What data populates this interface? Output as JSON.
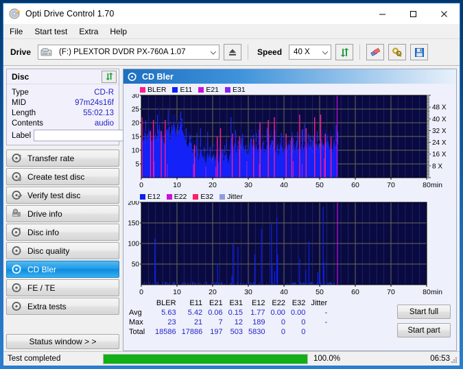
{
  "window": {
    "title": "Opti Drive Control 1.70",
    "icon": "disc-icon",
    "minimize": "–",
    "maximize": "□",
    "close": "✕"
  },
  "menu": {
    "items": [
      {
        "label": "File"
      },
      {
        "label": "Start test"
      },
      {
        "label": "Extra"
      },
      {
        "label": "Help"
      }
    ]
  },
  "toolbar": {
    "drive_label": "Drive",
    "drive_value": "(F:)  PLEXTOR DVDR   PX-760A 1.07",
    "eject_icon": "eject-icon",
    "speed_label": "Speed",
    "speed_value": "40 X",
    "refresh_icon": "refresh-arrows-icon",
    "erase_icon": "eraser-icon",
    "tools_icon": "tools-icon",
    "save_icon": "floppy-save-icon"
  },
  "disc_panel": {
    "title": "Disc",
    "refresh_icon": "refresh-arrows-icon",
    "rows": [
      {
        "key": "Type",
        "value": "CD-R"
      },
      {
        "key": "MID",
        "value": "97m24s16f"
      },
      {
        "key": "Length",
        "value": "55:02.13"
      },
      {
        "key": "Contents",
        "value": "audio"
      }
    ],
    "label_key": "Label",
    "label_value": "",
    "label_button_icon": "cd-label-icon"
  },
  "nav": {
    "items": [
      {
        "label": "Transfer rate",
        "icon": "disc-speed-icon",
        "selected": false
      },
      {
        "label": "Create test disc",
        "icon": "disc-burn-icon",
        "selected": false
      },
      {
        "label": "Verify test disc",
        "icon": "disc-check-icon",
        "selected": false
      },
      {
        "label": "Drive info",
        "icon": "drive-info-icon",
        "selected": false
      },
      {
        "label": "Disc info",
        "icon": "disc-info-icon",
        "selected": false
      },
      {
        "label": "Disc quality",
        "icon": "disc-quality-icon",
        "selected": false
      },
      {
        "label": "CD Bler",
        "icon": "cd-bler-icon",
        "selected": true
      },
      {
        "label": "FE / TE",
        "icon": "fe-te-icon",
        "selected": false
      },
      {
        "label": "Extra tests",
        "icon": "extra-tests-icon",
        "selected": false
      }
    ],
    "status_window_button": "Status window > >"
  },
  "panel": {
    "title": "CD Bler",
    "icon": "cd-bler-icon"
  },
  "stats": {
    "columns": [
      "BLER",
      "E11",
      "E21",
      "E31",
      "E12",
      "E22",
      "E32",
      "Jitter"
    ],
    "rows": [
      {
        "label": "Avg",
        "values": [
          "5.63",
          "5.42",
          "0.06",
          "0.15",
          "1.77",
          "0.00",
          "0.00",
          "-"
        ]
      },
      {
        "label": "Max",
        "values": [
          "23",
          "21",
          "7",
          "12",
          "189",
          "0",
          "0",
          "-"
        ]
      },
      {
        "label": "Total",
        "values": [
          "18586",
          "17886",
          "197",
          "503",
          "5830",
          "0",
          "0",
          ""
        ]
      }
    ]
  },
  "actions": {
    "start_full": "Start full",
    "start_part": "Start part"
  },
  "statusbar": {
    "text": "Test completed",
    "progress_pct": "100.0%",
    "progress_value": 100,
    "elapsed": "06:53"
  },
  "colors": {
    "bler": "#ff1d8e",
    "e11": "#0b22f0",
    "e21": "#c511e0",
    "e31": "#8a22f5",
    "e12": "#0b22f0",
    "e22": "#c511e0",
    "e32": "#ff1d66",
    "jitter": "#8f9ae6",
    "plot_bg": "#0a0a42",
    "grid": "#6a6a58",
    "progress": "#10b016",
    "accent": "#2323c8"
  },
  "chart_data": [
    {
      "type": "area",
      "id": "bler-chart",
      "title": "",
      "xlabel": "min",
      "ylabel": "",
      "xlim": [
        0,
        80
      ],
      "ylim": [
        0,
        30
      ],
      "xticks": [
        0,
        10,
        20,
        30,
        40,
        50,
        60,
        70,
        80
      ],
      "yticks": [
        5,
        10,
        15,
        20,
        25,
        30
      ],
      "y2ticks": [
        "8 X",
        "16 X",
        "24 X",
        "32 X",
        "40 X",
        "48 X"
      ],
      "y2lim": [
        0,
        56
      ],
      "grid": true,
      "legend": [
        {
          "name": "BLER",
          "color": "#ff1d8e"
        },
        {
          "name": "E11",
          "color": "#0b22f0"
        },
        {
          "name": "E21",
          "color": "#c511e0"
        },
        {
          "name": "E31",
          "color": "#8a22f5"
        }
      ],
      "data_end_min": 55.1,
      "series": [
        {
          "name": "E11",
          "color": "#0b22f0",
          "values": [
            14,
            16,
            13,
            15,
            12,
            17,
            14,
            13,
            16,
            18,
            15,
            14,
            13,
            16,
            12,
            15,
            17,
            14,
            16,
            13,
            21,
            17,
            15,
            14,
            16,
            13,
            12,
            15,
            18,
            17,
            19,
            15,
            14,
            13,
            16,
            18,
            21,
            19,
            17,
            15,
            16,
            18,
            17,
            19,
            21,
            18,
            17,
            16,
            15,
            14,
            13,
            12,
            11,
            13,
            12,
            14,
            10,
            9,
            11,
            8,
            7,
            9,
            10,
            8,
            6,
            9,
            11,
            10,
            8,
            7,
            9,
            6,
            5,
            8,
            10,
            7,
            9,
            6,
            8,
            5,
            7,
            9,
            6,
            8,
            10,
            7,
            5,
            9,
            8,
            11,
            10,
            7,
            6,
            9,
            8,
            10,
            7,
            5,
            8,
            9,
            16,
            14,
            12,
            10,
            13,
            11,
            9,
            12,
            10,
            8,
            11,
            13,
            10,
            9,
            12,
            10,
            8,
            11,
            9,
            7,
            10,
            12,
            15,
            13,
            11,
            14,
            12,
            10,
            13,
            11,
            9,
            12,
            14,
            11,
            10,
            13,
            12,
            9,
            11,
            10,
            13,
            11,
            9,
            12,
            10,
            14,
            12,
            10,
            13,
            11,
            9,
            12,
            10,
            8,
            11,
            13,
            10,
            12,
            9,
            11,
            10,
            12,
            9,
            11,
            13,
            10,
            8,
            12,
            11,
            9,
            13,
            10,
            12,
            9,
            11,
            10,
            12,
            9,
            11,
            13,
            12,
            10,
            13,
            11,
            9,
            12,
            14,
            11,
            13,
            10,
            12,
            9,
            11,
            14,
            12,
            10,
            13,
            11,
            9,
            12,
            14,
            11,
            13,
            10,
            12,
            15,
            13,
            11,
            14,
            12,
            10,
            13,
            11,
            9,
            12,
            14,
            11,
            13,
            10,
            12
          ]
        },
        {
          "name": "BLER",
          "color": "#ff1d8e",
          "spikes_min_value": [
            [
              0.1,
              22
            ],
            [
              2.5,
              17
            ],
            [
              3.3,
              21
            ],
            [
              5.5,
              17
            ],
            [
              6.6,
              21
            ],
            [
              14.8,
              12
            ],
            [
              21.2,
              15
            ],
            [
              22.1,
              18
            ],
            [
              25.4,
              16
            ],
            [
              27.5,
              15
            ],
            [
              31.4,
              14
            ],
            [
              33.2,
              20
            ],
            [
              35.5,
              21
            ],
            [
              37.2,
              22
            ],
            [
              40.5,
              16
            ],
            [
              42.1,
              15
            ],
            [
              44.3,
              23
            ],
            [
              46.1,
              18
            ],
            [
              48.5,
              22
            ],
            [
              50.2,
              23
            ],
            [
              51.5,
              16
            ],
            [
              53.1,
              15
            ]
          ]
        },
        {
          "name": "E21",
          "color": "#c511e0",
          "spikes_min_value": [
            [
              3.5,
              6
            ],
            [
              14.5,
              5
            ],
            [
              20.8,
              4
            ],
            [
              33.0,
              5
            ],
            [
              42.5,
              6
            ],
            [
              51.2,
              7
            ],
            [
              54.8,
              30
            ]
          ]
        },
        {
          "name": "E31",
          "color": "#8a22f5",
          "spikes_min_value": [
            [
              7.2,
              5
            ],
            [
              18.0,
              4
            ],
            [
              29.5,
              6
            ],
            [
              45.0,
              5
            ]
          ]
        }
      ]
    },
    {
      "type": "bar",
      "id": "e12-chart",
      "title": "",
      "xlabel": "min",
      "ylabel": "",
      "xlim": [
        0,
        80
      ],
      "ylim": [
        0,
        200
      ],
      "xticks": [
        0,
        10,
        20,
        30,
        40,
        50,
        60,
        70,
        80
      ],
      "yticks": [
        50,
        100,
        150,
        200
      ],
      "grid": true,
      "legend": [
        {
          "name": "E12",
          "color": "#0b22f0"
        },
        {
          "name": "E22",
          "color": "#c511e0"
        },
        {
          "name": "E32",
          "color": "#ff1d66"
        },
        {
          "name": "Jitter",
          "color": "#8f9ae6"
        }
      ],
      "data_end_min": 55.1,
      "series": [
        {
          "name": "E12",
          "color": "#0b22f0",
          "spikes_min_value": [
            [
              3.7,
              113
            ],
            [
              3.8,
              55
            ],
            [
              21.3,
              52
            ],
            [
              25.3,
              22
            ],
            [
              25.6,
              98
            ],
            [
              27.0,
              92
            ],
            [
              31.7,
              74
            ],
            [
              33.6,
              136
            ],
            [
              36.4,
              148
            ],
            [
              36.6,
              48
            ],
            [
              37.3,
              33
            ],
            [
              37.9,
              163
            ],
            [
              38.1,
              73
            ],
            [
              44.3,
              62
            ],
            [
              46.0,
              35
            ],
            [
              46.9,
              105
            ],
            [
              49.4,
              30
            ],
            [
              49.8,
              28
            ],
            [
              50.9,
              189
            ],
            [
              51.1,
              55
            ]
          ]
        },
        {
          "name": "E22",
          "color": "#c511e0",
          "spikes_min_value": [
            [
              54.9,
              200
            ]
          ]
        }
      ]
    }
  ]
}
